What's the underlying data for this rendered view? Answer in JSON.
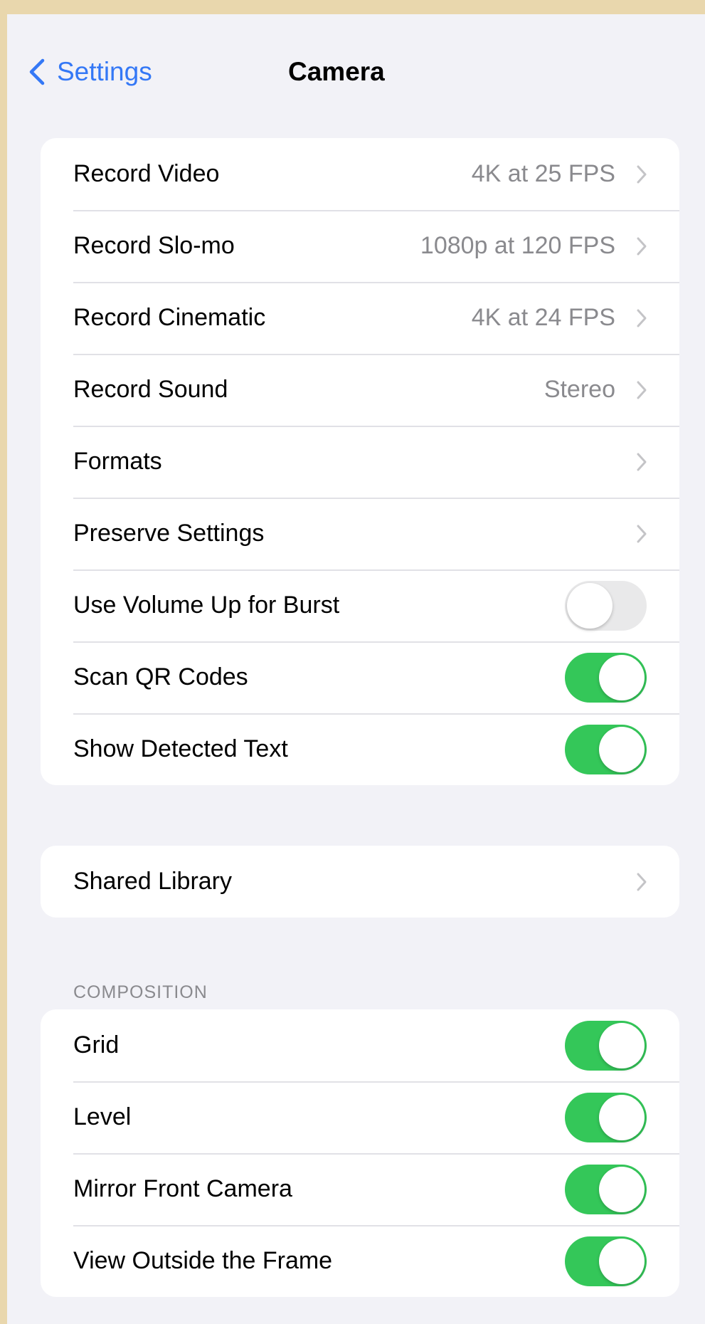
{
  "nav": {
    "back_label": "Settings",
    "title": "Camera"
  },
  "colors": {
    "accent": "#3478f6",
    "toggle_on": "#34c759",
    "toggle_off": "#e9e9ea",
    "secondary_text": "#8a8a8e"
  },
  "group1": {
    "rows": [
      {
        "label": "Record Video",
        "value": "4K at 25 FPS"
      },
      {
        "label": "Record Slo-mo",
        "value": "1080p at 120 FPS"
      },
      {
        "label": "Record Cinematic",
        "value": "4K at 24 FPS"
      },
      {
        "label": "Record Sound",
        "value": "Stereo"
      },
      {
        "label": "Formats"
      },
      {
        "label": "Preserve Settings"
      },
      {
        "label": "Use Volume Up for Burst",
        "toggle": false
      },
      {
        "label": "Scan QR Codes",
        "toggle": true
      },
      {
        "label": "Show Detected Text",
        "toggle": true
      }
    ]
  },
  "group2": {
    "rows": [
      {
        "label": "Shared Library"
      }
    ]
  },
  "composition": {
    "header": "COMPOSITION",
    "rows": [
      {
        "label": "Grid",
        "toggle": true
      },
      {
        "label": "Level",
        "toggle": true
      },
      {
        "label": "Mirror Front Camera",
        "toggle": true
      },
      {
        "label": "View Outside the Frame",
        "toggle": true
      }
    ]
  }
}
